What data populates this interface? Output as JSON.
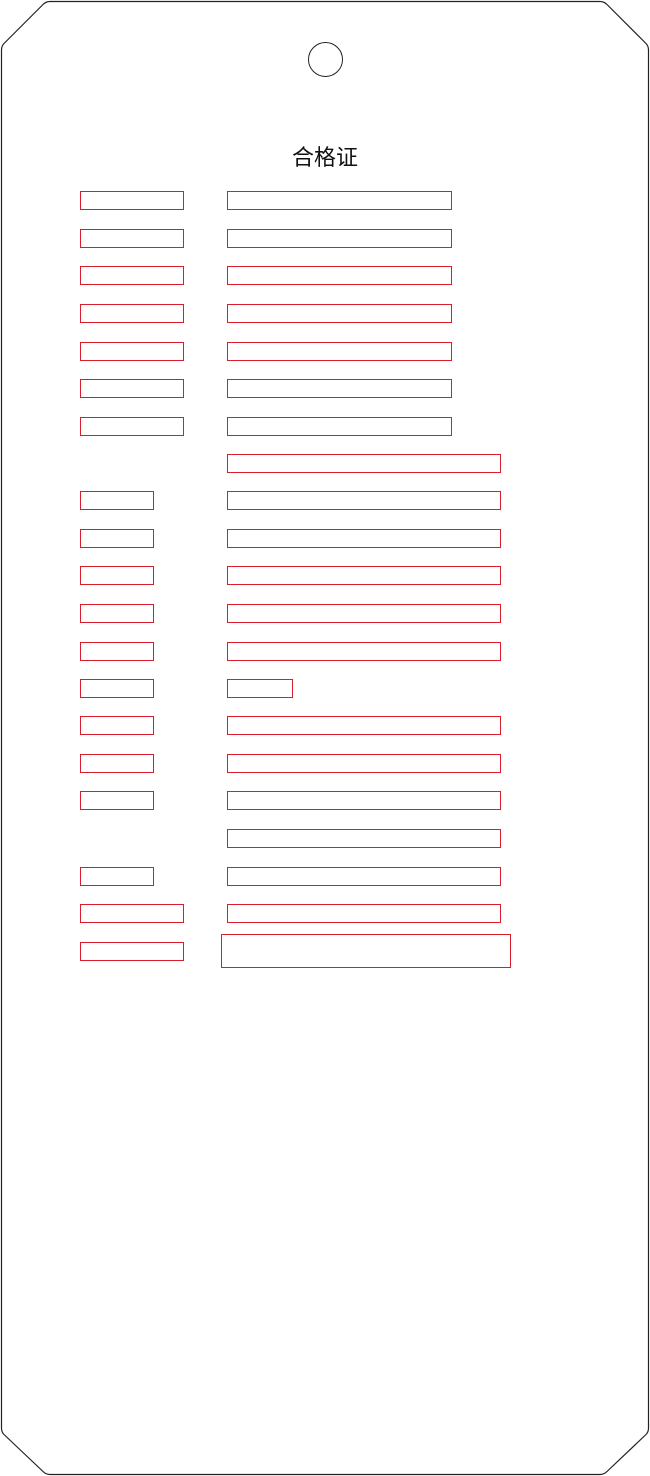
{
  "tag": {
    "title": "合格证",
    "outline_color": "#222222",
    "field_border_color": "#d81e2c"
  },
  "rows": [
    {
      "label_empty": true,
      "value_empty": true
    },
    {
      "label_empty": true,
      "value_empty": true
    },
    {
      "label_empty": true,
      "value_empty": true
    },
    {
      "label_empty": true,
      "value_empty": true
    },
    {
      "label_empty": true,
      "value_empty": true
    },
    {
      "label_empty": true,
      "value_empty": true
    },
    {
      "label_empty": true,
      "value_empty": true
    },
    {
      "value_empty": true
    },
    {
      "label_empty": true,
      "value_empty": true
    },
    {
      "label_empty": true,
      "value_empty": true
    },
    {
      "label_empty": true,
      "value_empty": true
    },
    {
      "label_empty": true,
      "value_empty": true
    },
    {
      "label_empty": true,
      "value_empty": true
    },
    {
      "label_empty": true,
      "value_empty": true
    },
    {
      "label_empty": true,
      "value_empty": true
    },
    {
      "label_empty": true,
      "value_empty": true
    },
    {
      "label_empty": true,
      "value_empty": true
    },
    {
      "value_empty": true
    },
    {
      "label_empty": true,
      "value_empty": true
    },
    {
      "label_empty": true,
      "value_empty": true
    },
    {
      "label_empty": true,
      "value_empty": true
    }
  ]
}
